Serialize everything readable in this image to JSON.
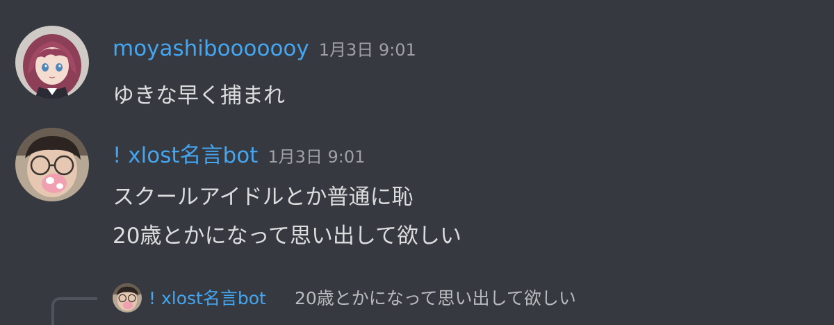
{
  "theme": {
    "background": "#36393f",
    "username_color": "#44a5f0",
    "text_color": "#dcddde",
    "timestamp_color": "#9fa1a6",
    "muted_text_color": "#b9bbbe"
  },
  "messages": [
    {
      "username": "moyashibooooooy",
      "timestamp": "1月3日 9:01",
      "lines": [
        "ゆきな早く捕まれ"
      ],
      "avatar_icon": "anime-girl-avatar"
    },
    {
      "username": "! xlost名言bot",
      "timestamp": "1月3日 9:01",
      "lines": [
        "スクールアイドルとか普通に恥",
        "20歳とかになって思い出して欲しい"
      ],
      "avatar_icon": "user-photo-avatar"
    }
  ],
  "reply_preview": {
    "username": "! xlost名言bot",
    "text": "20歳とかになって思い出して欲しい",
    "avatar_icon": "user-photo-avatar"
  }
}
